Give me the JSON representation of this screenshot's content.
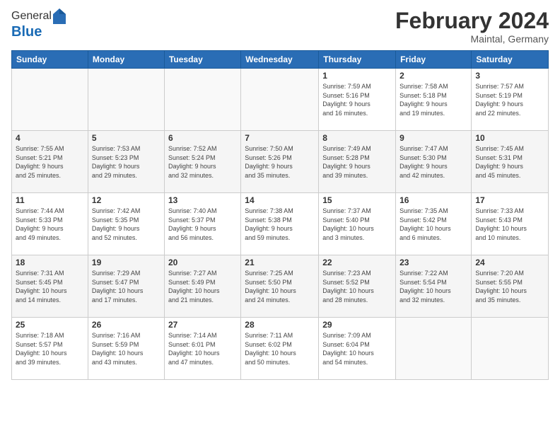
{
  "header": {
    "logo_general": "General",
    "logo_blue": "Blue",
    "month_title": "February 2024",
    "subtitle": "Maintal, Germany"
  },
  "days_of_week": [
    "Sunday",
    "Monday",
    "Tuesday",
    "Wednesday",
    "Thursday",
    "Friday",
    "Saturday"
  ],
  "weeks": [
    {
      "days": [
        {
          "number": "",
          "info": ""
        },
        {
          "number": "",
          "info": ""
        },
        {
          "number": "",
          "info": ""
        },
        {
          "number": "",
          "info": ""
        },
        {
          "number": "1",
          "info": "Sunrise: 7:59 AM\nSunset: 5:16 PM\nDaylight: 9 hours\nand 16 minutes."
        },
        {
          "number": "2",
          "info": "Sunrise: 7:58 AM\nSunset: 5:18 PM\nDaylight: 9 hours\nand 19 minutes."
        },
        {
          "number": "3",
          "info": "Sunrise: 7:57 AM\nSunset: 5:19 PM\nDaylight: 9 hours\nand 22 minutes."
        }
      ]
    },
    {
      "days": [
        {
          "number": "4",
          "info": "Sunrise: 7:55 AM\nSunset: 5:21 PM\nDaylight: 9 hours\nand 25 minutes."
        },
        {
          "number": "5",
          "info": "Sunrise: 7:53 AM\nSunset: 5:23 PM\nDaylight: 9 hours\nand 29 minutes."
        },
        {
          "number": "6",
          "info": "Sunrise: 7:52 AM\nSunset: 5:24 PM\nDaylight: 9 hours\nand 32 minutes."
        },
        {
          "number": "7",
          "info": "Sunrise: 7:50 AM\nSunset: 5:26 PM\nDaylight: 9 hours\nand 35 minutes."
        },
        {
          "number": "8",
          "info": "Sunrise: 7:49 AM\nSunset: 5:28 PM\nDaylight: 9 hours\nand 39 minutes."
        },
        {
          "number": "9",
          "info": "Sunrise: 7:47 AM\nSunset: 5:30 PM\nDaylight: 9 hours\nand 42 minutes."
        },
        {
          "number": "10",
          "info": "Sunrise: 7:45 AM\nSunset: 5:31 PM\nDaylight: 9 hours\nand 45 minutes."
        }
      ]
    },
    {
      "days": [
        {
          "number": "11",
          "info": "Sunrise: 7:44 AM\nSunset: 5:33 PM\nDaylight: 9 hours\nand 49 minutes."
        },
        {
          "number": "12",
          "info": "Sunrise: 7:42 AM\nSunset: 5:35 PM\nDaylight: 9 hours\nand 52 minutes."
        },
        {
          "number": "13",
          "info": "Sunrise: 7:40 AM\nSunset: 5:37 PM\nDaylight: 9 hours\nand 56 minutes."
        },
        {
          "number": "14",
          "info": "Sunrise: 7:38 AM\nSunset: 5:38 PM\nDaylight: 9 hours\nand 59 minutes."
        },
        {
          "number": "15",
          "info": "Sunrise: 7:37 AM\nSunset: 5:40 PM\nDaylight: 10 hours\nand 3 minutes."
        },
        {
          "number": "16",
          "info": "Sunrise: 7:35 AM\nSunset: 5:42 PM\nDaylight: 10 hours\nand 6 minutes."
        },
        {
          "number": "17",
          "info": "Sunrise: 7:33 AM\nSunset: 5:43 PM\nDaylight: 10 hours\nand 10 minutes."
        }
      ]
    },
    {
      "days": [
        {
          "number": "18",
          "info": "Sunrise: 7:31 AM\nSunset: 5:45 PM\nDaylight: 10 hours\nand 14 minutes."
        },
        {
          "number": "19",
          "info": "Sunrise: 7:29 AM\nSunset: 5:47 PM\nDaylight: 10 hours\nand 17 minutes."
        },
        {
          "number": "20",
          "info": "Sunrise: 7:27 AM\nSunset: 5:49 PM\nDaylight: 10 hours\nand 21 minutes."
        },
        {
          "number": "21",
          "info": "Sunrise: 7:25 AM\nSunset: 5:50 PM\nDaylight: 10 hours\nand 24 minutes."
        },
        {
          "number": "22",
          "info": "Sunrise: 7:23 AM\nSunset: 5:52 PM\nDaylight: 10 hours\nand 28 minutes."
        },
        {
          "number": "23",
          "info": "Sunrise: 7:22 AM\nSunset: 5:54 PM\nDaylight: 10 hours\nand 32 minutes."
        },
        {
          "number": "24",
          "info": "Sunrise: 7:20 AM\nSunset: 5:55 PM\nDaylight: 10 hours\nand 35 minutes."
        }
      ]
    },
    {
      "days": [
        {
          "number": "25",
          "info": "Sunrise: 7:18 AM\nSunset: 5:57 PM\nDaylight: 10 hours\nand 39 minutes."
        },
        {
          "number": "26",
          "info": "Sunrise: 7:16 AM\nSunset: 5:59 PM\nDaylight: 10 hours\nand 43 minutes."
        },
        {
          "number": "27",
          "info": "Sunrise: 7:14 AM\nSunset: 6:01 PM\nDaylight: 10 hours\nand 47 minutes."
        },
        {
          "number": "28",
          "info": "Sunrise: 7:11 AM\nSunset: 6:02 PM\nDaylight: 10 hours\nand 50 minutes."
        },
        {
          "number": "29",
          "info": "Sunrise: 7:09 AM\nSunset: 6:04 PM\nDaylight: 10 hours\nand 54 minutes."
        },
        {
          "number": "",
          "info": ""
        },
        {
          "number": "",
          "info": ""
        }
      ]
    }
  ]
}
